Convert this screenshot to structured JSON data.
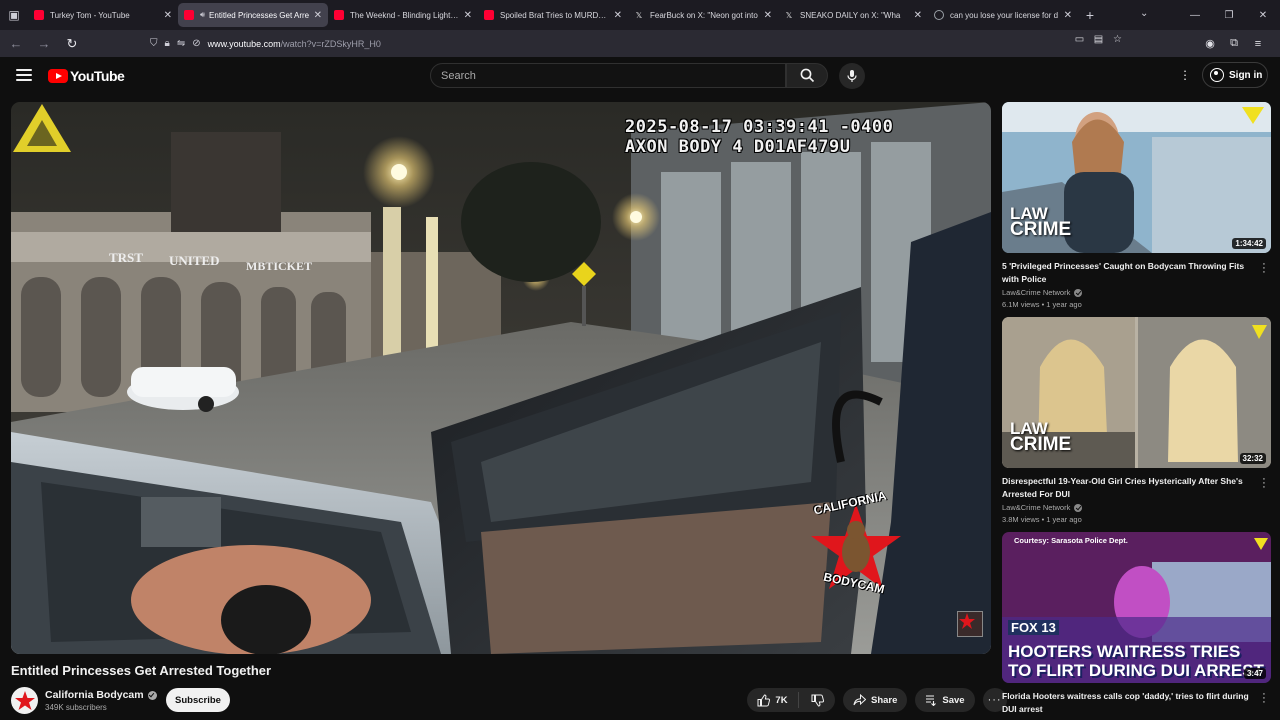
{
  "browser": {
    "tabs": [
      {
        "title": "Turkey Tom - YouTube",
        "icon": "youtube-favicon",
        "active": false
      },
      {
        "title": "Entitled Princesses Get Arre",
        "icon": "youtube-favicon",
        "active": true,
        "audio": true
      },
      {
        "title": "The Weeknd - Blinding Lights (C",
        "icon": "youtube-favicon",
        "active": false
      },
      {
        "title": "Spoiled Brat Tries to MURDER U",
        "icon": "youtube-favicon",
        "active": false
      },
      {
        "title": "FearBuck on X: \"Neon got into",
        "icon": "x-favicon",
        "active": false
      },
      {
        "title": "SNEAKO DAILY on X: \"Wha",
        "icon": "x-favicon",
        "active": false
      },
      {
        "title": "can you lose your license for d",
        "icon": "google-favicon",
        "active": false
      }
    ],
    "url_host": "www.youtube.com",
    "url_path": "/watch?v=rZDSkyHR_H0"
  },
  "header": {
    "logo_text": "YouTube",
    "search_placeholder": "Search",
    "signin_label": "Sign in"
  },
  "video": {
    "overlay_timestamp": "2025-08-17 03:39:41 -0400",
    "overlay_device": "AXON BODY 4 D01AF479U",
    "watermark_top": "CALIFORNIA",
    "watermark_bottom": "BODYCAM",
    "title": "Entitled Princesses Get Arrested Together",
    "channel": "California Bodycam",
    "subscribers": "349K subscribers",
    "subscribe_label": "Subscribe",
    "likes": "7K",
    "share_label": "Share",
    "save_label": "Save"
  },
  "recommendations": [
    {
      "title": "5 'Privileged Princesses' Caught on Bodycam Throwing Fits with Police",
      "channel": "Law&Crime Network",
      "meta": "6.1M views • 1 year ago",
      "duration": "1:34:42",
      "thumb_line1": "LAW",
      "thumb_line2": "CRIME"
    },
    {
      "title": "Disrespectful 19-Year-Old Girl Cries Hysterically After She's Arrested For DUI",
      "channel": "Law&Crime Network",
      "meta": "3.8M views • 1 year ago",
      "duration": "32:32",
      "thumb_line1": "LAW",
      "thumb_line2": "CRIME"
    },
    {
      "title": "Florida Hooters waitress calls cop 'daddy,' tries to flirt during DUI arrest",
      "duration": "3:47",
      "thumb_caption": "Courtesy: Sarasota Police Dept.",
      "thumb_station": "FOX 13",
      "thumb_line1": "HOOTERS WAITRESS TRIES",
      "thumb_line2": "TO FLIRT DURING DUI ARREST"
    }
  ]
}
